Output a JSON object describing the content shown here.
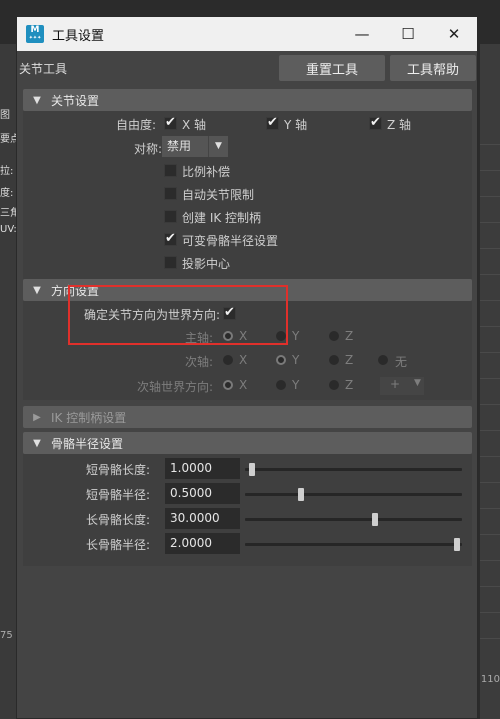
{
  "background": {
    "left_labels": [
      "图",
      "要点",
      "拉:",
      "度:",
      "三角",
      "UV:"
    ],
    "ruler_left": "75",
    "ruler_right": "110"
  },
  "window": {
    "title": "工具设置",
    "minimize": "—",
    "maximize": "☐",
    "close": "✕"
  },
  "header": {
    "tool_name": "关节工具",
    "reset_label": "重置工具",
    "help_label": "工具帮助"
  },
  "joint_settings": {
    "title": "关节设置",
    "dof_label": "自由度:",
    "x_axis": "X 轴",
    "y_axis": "Y 轴",
    "z_axis": "Z 轴",
    "symmetry_label": "对称:",
    "symmetry_value": "禁用",
    "options": [
      {
        "label": "比例补偿",
        "checked": false
      },
      {
        "label": "自动关节限制",
        "checked": false
      },
      {
        "label": "创建 IK 控制柄",
        "checked": false
      },
      {
        "label": "可变骨骼半径设置",
        "checked": true
      },
      {
        "label": "投影中心",
        "checked": false
      }
    ]
  },
  "orientation": {
    "title": "方向设置",
    "orient_label": "确定关节方向为世界方向:",
    "primary_label": "主轴:",
    "secondary_label": "次轴:",
    "secondary_world_label": "次轴世界方向:",
    "x": "X",
    "y": "Y",
    "z": "Z",
    "none": "无",
    "plus": "+"
  },
  "ik_section": {
    "title": "IK 控制柄设置"
  },
  "bone_radius": {
    "title": "骨骼半径设置",
    "rows": [
      {
        "label": "短骨骼长度:",
        "value": "1.0000",
        "level": 0.0
      },
      {
        "label": "短骨骼半径:",
        "value": "0.5000",
        "level": 0.24
      },
      {
        "label": "长骨骼长度:",
        "value": "30.0000",
        "level": 0.6
      },
      {
        "label": "长骨骼半径:",
        "value": "2.0000",
        "level": 1.0
      }
    ]
  },
  "colors": {
    "highlight_box": "#e0302b"
  }
}
